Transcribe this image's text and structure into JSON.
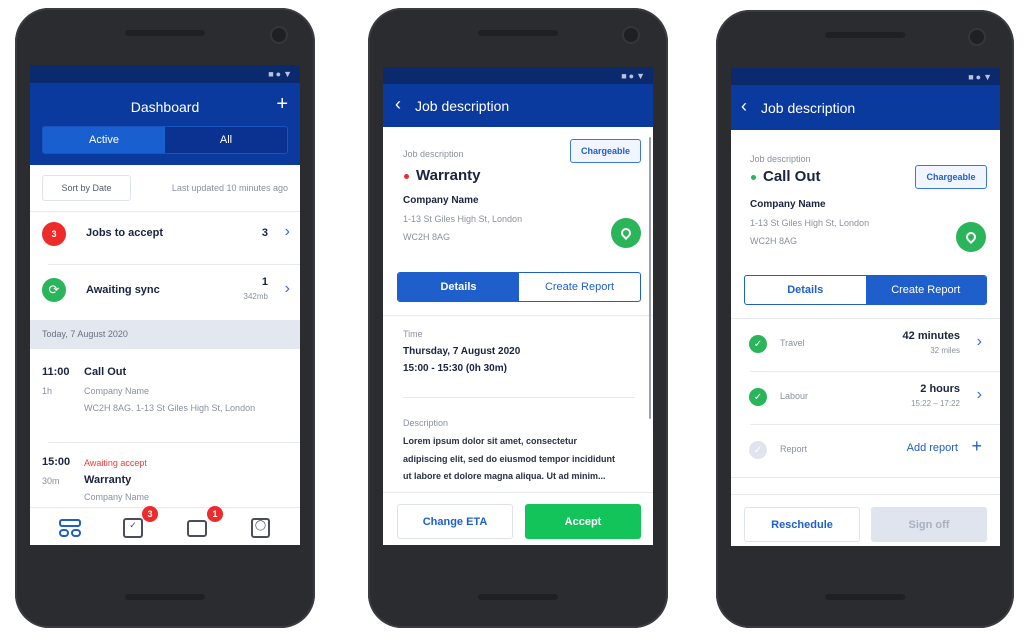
{
  "status_icons": "■●▼",
  "dashboard": {
    "title": "Dashboard",
    "add_icon": "+",
    "tabs": [
      "Active",
      "All"
    ],
    "sort_label": "Sort by Date",
    "last_updated": "Last updated 10 minutes ago",
    "jobs_to_accept": {
      "badge": "3",
      "label": "Jobs to accept",
      "count": "3"
    },
    "awaiting_sync": {
      "label": "Awaiting sync",
      "count": "1",
      "size": "342mb"
    },
    "date_header": "Today, 7 August 2020",
    "jobs": [
      {
        "time": "11:00",
        "duration": "1h",
        "title": "Call Out",
        "company": "Company Name",
        "address": "WC2H 8AG. 1-13 St Giles High St, London"
      },
      {
        "time": "15:00",
        "duration": "30m",
        "status": "Awaiting accept",
        "title": "Warranty",
        "company": "Company Name"
      }
    ],
    "nav": {
      "calendar_badge": "3",
      "inbox_badge": "1"
    }
  },
  "warranty": {
    "header": "Job description",
    "label": "Job description",
    "chargeable": "Chargeable",
    "title": "Warranty",
    "company": "Company Name",
    "address1": "1-13 St Giles High St, London",
    "address2": "WC2H 8AG",
    "tabs": [
      "Details",
      "Create Report"
    ],
    "time_label": "Time",
    "date": "Thursday, 7 August 2020",
    "time_range": "15:00 - 15:30 (0h 30m)",
    "desc_label": "Description",
    "desc_lines": [
      "Lorem ipsum dolor sit amet, consectetur",
      "adipiscing elit, sed do eiusmod tempor incididunt",
      "ut labore et dolore magna aliqua. Ut ad minim..."
    ],
    "change_eta": "Change ETA",
    "accept": "Accept"
  },
  "callout": {
    "header": "Job description",
    "label": "Job description",
    "chargeable": "Chargeable",
    "title": "Call Out",
    "company": "Company Name",
    "address1": "1-13 St Giles High St, London",
    "address2": "WC2H 8AG",
    "tabs": [
      "Details",
      "Create Report"
    ],
    "travel": {
      "label": "Travel",
      "value": "42 minutes",
      "sub": "32 miles"
    },
    "labour": {
      "label": "Labour",
      "value": "2 hours",
      "sub": "15:22 – 17:22"
    },
    "report": {
      "label": "Report",
      "action": "Add report"
    },
    "reschedule": "Reschedule",
    "sign_off": "Sign off"
  },
  "colors": {
    "primary": "#0b3a9e",
    "accent": "#1f5fcc",
    "success": "#2bb55a",
    "danger": "#ee2b2b",
    "accept": "#13c45a"
  }
}
